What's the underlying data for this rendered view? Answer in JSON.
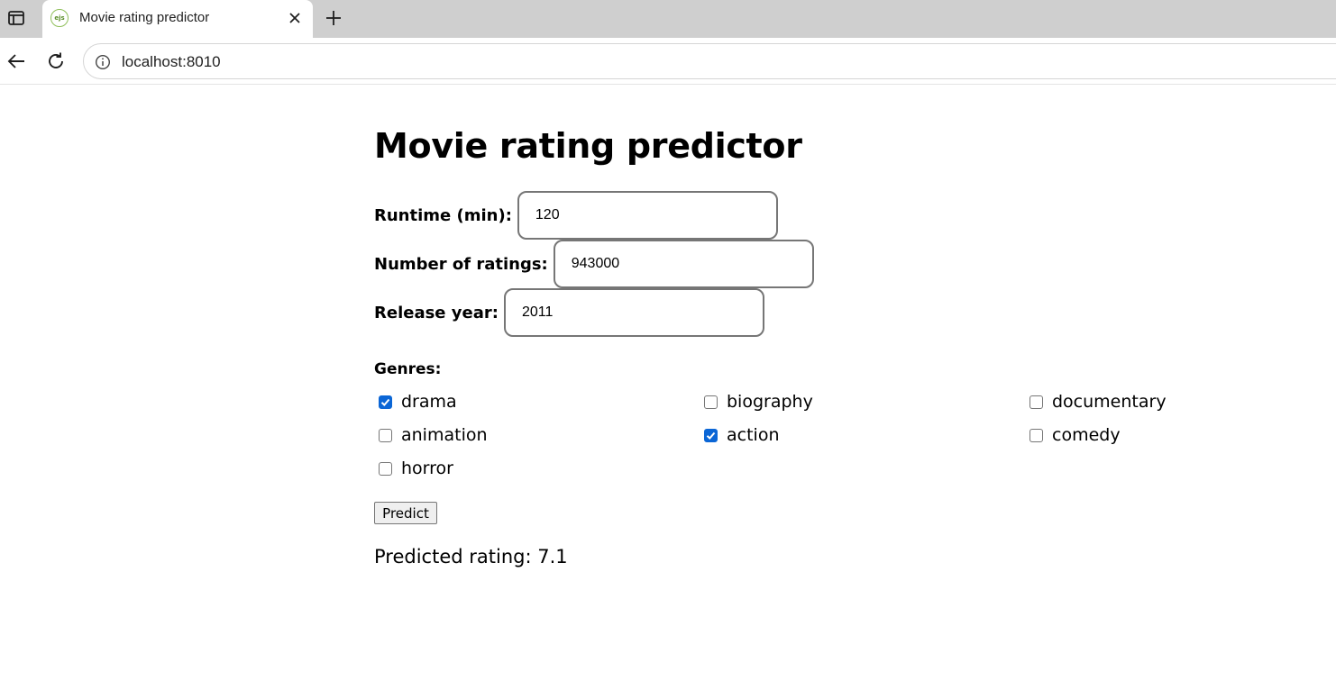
{
  "browser": {
    "tab_title": "Movie rating predictor",
    "favicon_text": "ejs",
    "url": "localhost:8010"
  },
  "page": {
    "title": "Movie rating predictor",
    "fields": [
      {
        "label": "Runtime (min):",
        "value": "120"
      },
      {
        "label": "Number of ratings:",
        "value": "943000"
      },
      {
        "label": "Release year:",
        "value": "2011"
      }
    ],
    "genres_heading": "Genres:",
    "genres": [
      {
        "label": "drama",
        "checked": true
      },
      {
        "label": "biography",
        "checked": false
      },
      {
        "label": "documentary",
        "checked": false
      },
      {
        "label": "animation",
        "checked": false
      },
      {
        "label": "action",
        "checked": true
      },
      {
        "label": "comedy",
        "checked": false
      },
      {
        "label": "horror",
        "checked": false
      }
    ],
    "predict_label": "Predict",
    "result_text": "Predicted rating: 7.1"
  },
  "colors": {
    "checkbox_checked": "#0b66d6",
    "tabbar_bg": "#cfcfcf"
  },
  "icons": [
    "tab-switcher-icon",
    "ejs-favicon-icon",
    "close-icon",
    "plus-icon",
    "back-arrow-icon",
    "reload-icon",
    "info-icon",
    "checkmark-icon"
  ]
}
